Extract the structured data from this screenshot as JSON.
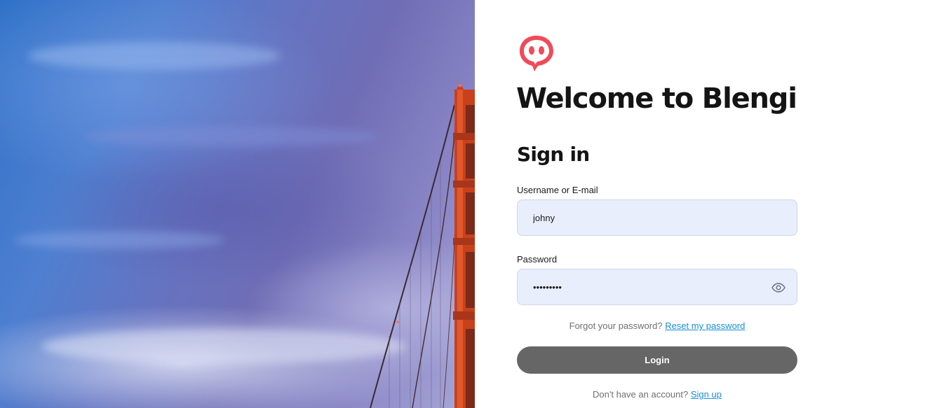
{
  "brand": {
    "accent": "#f04b59",
    "logo_icon": "speech-bubble-face-icon"
  },
  "heading": {
    "welcome": "Welcome to Blengi",
    "form_title": "Sign in"
  },
  "form": {
    "username_label": "Username or E-mail",
    "username_value": "johny",
    "password_label": "Password",
    "password_value": "•••••••••",
    "password_toggle_icon": "eye-icon",
    "forgot_text": "Forgot your password?",
    "reset_link": "Reset my password",
    "login_label": "Login",
    "signup_text": "Don't have an account?",
    "signup_link": "Sign up"
  },
  "colors": {
    "input_bg": "#e8eefc",
    "button_bg": "#666666",
    "link": "#1a8fd6"
  }
}
